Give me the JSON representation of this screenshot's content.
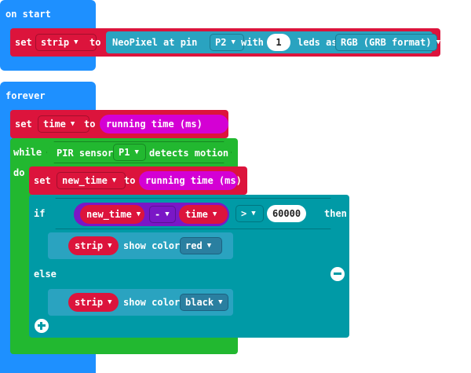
{
  "colors": {
    "event": "#1e90ff",
    "variable": "#dc143c",
    "loop": "#22b830",
    "logic": "#009aa6",
    "math": "#7a17c6",
    "time_reporter": "#d400d4",
    "neopixel": "#2aa3c0"
  },
  "on_start": {
    "label": "on start",
    "set": {
      "keyword": "set",
      "variable": "strip",
      "to": "to",
      "neopixel_label": "NeoPixel at pin",
      "pin": "P2",
      "with": "with",
      "count": "1",
      "leds_as": "leds as",
      "format": "RGB (GRB format)"
    }
  },
  "forever": {
    "label": "forever",
    "set_time": {
      "keyword": "set",
      "variable": "time",
      "to": "to",
      "value": "running time (ms)"
    },
    "while": {
      "keyword": "while",
      "sensor_label": "PIR sensor",
      "pin": "P1",
      "detects": "detects motion",
      "do": "do"
    },
    "set_new_time": {
      "keyword": "set",
      "variable": "new_time",
      "to": "to",
      "value": "running time (ms)"
    },
    "if_block": {
      "if": "if",
      "left_var": "new_time",
      "operator": "-",
      "right_var": "time",
      "compare": ">",
      "threshold": "60000",
      "then": "then",
      "else": "else"
    },
    "show_red": {
      "variable": "strip",
      "action": "show color",
      "color": "red"
    },
    "show_black": {
      "variable": "strip",
      "action": "show color",
      "color": "black"
    }
  }
}
